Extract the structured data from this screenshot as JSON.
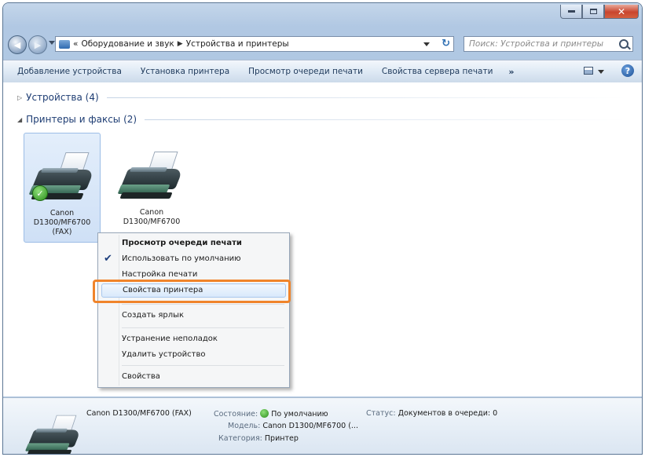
{
  "address": {
    "prefix": "«",
    "crumb1": "Оборудование и звук",
    "crumb2": "Устройства и принтеры",
    "refresh_glyph": "↻"
  },
  "search": {
    "placeholder": "Поиск: Устройства и принтеры"
  },
  "commands": {
    "add_device": "Добавление устройства",
    "install_printer": "Установка принтера",
    "view_queue": "Просмотр очереди печати",
    "server_props": "Свойства сервера печати",
    "more": "»",
    "help": "?"
  },
  "groups": {
    "devices": "Устройства (4)",
    "printers": "Принтеры и факсы (2)",
    "collapsed_glyph": "▷",
    "expanded_glyph": "◢"
  },
  "devices": [
    {
      "name_line1": "Canon",
      "name_line2": "D1300/MF6700",
      "name_line3": "(FAX)",
      "default": true,
      "selected": true
    },
    {
      "name_line1": "Canon",
      "name_line2": "D1300/MF6700",
      "name_line3": "",
      "default": false,
      "selected": false
    }
  ],
  "context_menu": {
    "items": [
      "Просмотр очереди печати",
      "Использовать по умолчанию",
      "Настройка печати",
      "Свойства принтера",
      "Создать ярлык",
      "Устранение неполадок",
      "Удалить устройство",
      "Свойства"
    ],
    "check_glyph": "✔",
    "highlighted_index": 3
  },
  "details": {
    "name": "Canon D1300/MF6700 (FAX)",
    "state_label": "Состояние:",
    "state_value": "По умолчанию",
    "status_label": "Статус:",
    "status_value": "Документов в очереди: 0",
    "model_label": "Модель:",
    "model_value": "Canon D1300/MF6700 (...",
    "category_label": "Категория:",
    "category_value": "Принтер"
  },
  "colors": {
    "highlight_outline": "#f0842b",
    "window_frame": "#b1c8e3",
    "link_text": "#1e3d73"
  },
  "icons": {
    "back": "back-arrow-icon",
    "forward": "forward-arrow-icon",
    "search": "search-icon",
    "help": "help-icon",
    "default_printer": "checkmark-icon"
  }
}
